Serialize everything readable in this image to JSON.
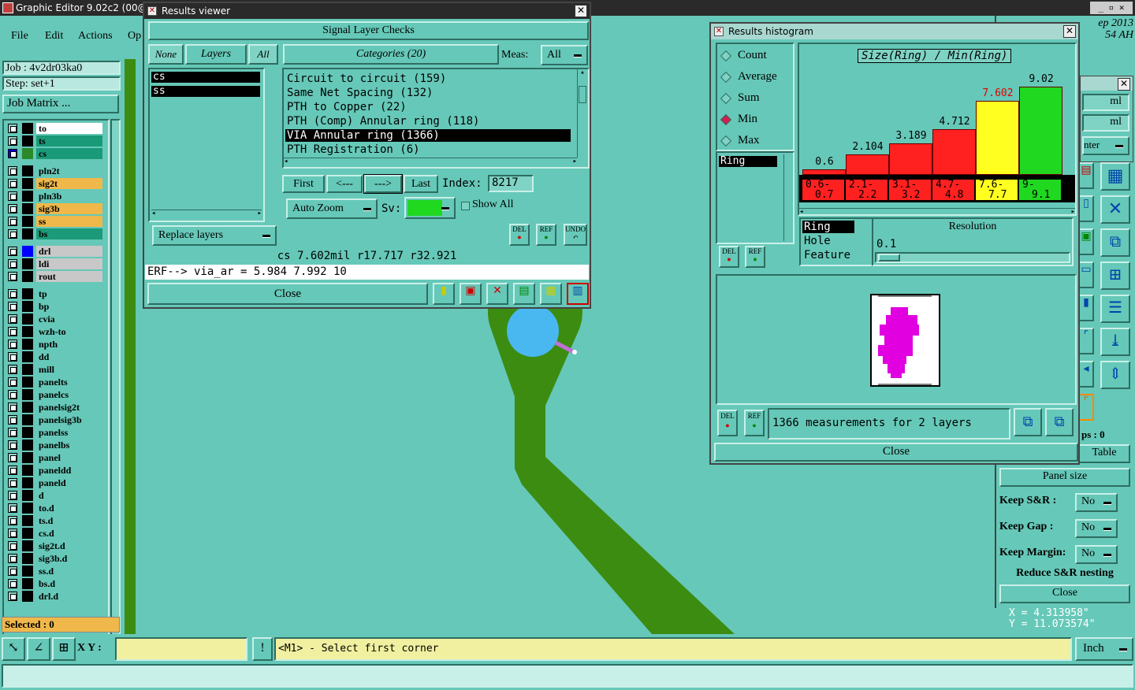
{
  "app": {
    "title": "Graphic Editor 9.02c2 (00@H",
    "date_frag1": "ep 2013",
    "date_frag2": "54 AH"
  },
  "menu": {
    "file": "File",
    "edit": "Edit",
    "actions": "Actions",
    "op": "Op"
  },
  "left": {
    "job": "Job : 4v2dr03ka0",
    "step": "Step: set+1",
    "job_matrix": "Job Matrix ...",
    "selected": "Selected : 0",
    "layers": [
      {
        "name": "to",
        "color": "#ffffff",
        "sw": "#000"
      },
      {
        "name": "ts",
        "color": "#1a9a78",
        "sw": "#000"
      },
      {
        "name": "cs",
        "color": "#1a9a78",
        "sw": "#2a8a2a",
        "active": true
      },
      {
        "name": "pln2t",
        "color": "#66c8b8",
        "sw": "#000"
      },
      {
        "name": "sig2t",
        "color": "#f0b84a",
        "sw": "#000"
      },
      {
        "name": "pln3b",
        "color": "#66c8b8",
        "sw": "#000"
      },
      {
        "name": "sig3b",
        "color": "#f0b84a",
        "sw": "#000"
      },
      {
        "name": "ss",
        "color": "#f0b84a",
        "sw": "#000"
      },
      {
        "name": "bs",
        "color": "#1a9a78",
        "sw": "#000"
      },
      {
        "name": "drl",
        "color": "#c8c8c8",
        "sw": "#0000ff"
      },
      {
        "name": "ldi",
        "color": "#c8c8c8",
        "sw": "#000"
      },
      {
        "name": "rout",
        "color": "#c8c8c8",
        "sw": "#000"
      },
      {
        "name": "tp",
        "color": "#66c8b8",
        "sw": "#000"
      },
      {
        "name": "bp",
        "color": "#66c8b8",
        "sw": "#000"
      },
      {
        "name": "cvia",
        "color": "#66c8b8",
        "sw": "#000"
      },
      {
        "name": "wzh-to",
        "color": "#66c8b8",
        "sw": "#000"
      },
      {
        "name": "npth",
        "color": "#66c8b8",
        "sw": "#000"
      },
      {
        "name": "dd",
        "color": "#66c8b8",
        "sw": "#000"
      },
      {
        "name": "mill",
        "color": "#66c8b8",
        "sw": "#000"
      },
      {
        "name": "panelts",
        "color": "#66c8b8",
        "sw": "#000"
      },
      {
        "name": "panelcs",
        "color": "#66c8b8",
        "sw": "#000"
      },
      {
        "name": "panelsig2t",
        "color": "#66c8b8",
        "sw": "#000"
      },
      {
        "name": "panelsig3b",
        "color": "#66c8b8",
        "sw": "#000"
      },
      {
        "name": "panelss",
        "color": "#66c8b8",
        "sw": "#000"
      },
      {
        "name": "panelbs",
        "color": "#66c8b8",
        "sw": "#000"
      },
      {
        "name": "panel",
        "color": "#66c8b8",
        "sw": "#000"
      },
      {
        "name": "paneldd",
        "color": "#66c8b8",
        "sw": "#000"
      },
      {
        "name": "paneld",
        "color": "#66c8b8",
        "sw": "#000"
      },
      {
        "name": "d",
        "color": "#66c8b8",
        "sw": "#000"
      },
      {
        "name": "to.d",
        "color": "#66c8b8",
        "sw": "#000"
      },
      {
        "name": "ts.d",
        "color": "#66c8b8",
        "sw": "#000"
      },
      {
        "name": "cs.d",
        "color": "#66c8b8",
        "sw": "#000"
      },
      {
        "name": "sig2t.d",
        "color": "#66c8b8",
        "sw": "#000"
      },
      {
        "name": "sig3b.d",
        "color": "#66c8b8",
        "sw": "#000"
      },
      {
        "name": "ss.d",
        "color": "#66c8b8",
        "sw": "#000"
      },
      {
        "name": "bs.d",
        "color": "#66c8b8",
        "sw": "#000"
      },
      {
        "name": "drl.d",
        "color": "#66c8b8",
        "sw": "#000"
      }
    ]
  },
  "rv": {
    "title": "Results viewer",
    "header": "Signal Layer Checks",
    "none": "None",
    "layers": "Layers",
    "all": "All",
    "categories": "Categories (20)",
    "meas_label": "Meas:",
    "meas_value": "All",
    "layer_items": [
      "cs",
      "ss"
    ],
    "cat_items": [
      "Circuit to circuit (159)",
      "Same Net Spacing (132)",
      "PTH to Copper (22)",
      "PTH (Comp) Annular ring (118)",
      "VIA Annular ring (1366)",
      "PTH Registration (6)"
    ],
    "first": "First",
    "prev": "<---",
    "next": "--->",
    "last": "Last",
    "index_label": "Index:",
    "index_value": "8217",
    "auto_zoom": "Auto Zoom",
    "sv": "Sv:",
    "show_all": "Show All",
    "replace": "Replace layers",
    "del": "DEL",
    "ref": "REF",
    "undo": "UNDO",
    "status": "cs 7.602mil  r17.717  r32.921",
    "erf": "ERF--> via_ar = 5.984 7.992 10",
    "close": "Close"
  },
  "rh": {
    "title": "Results histogram",
    "chart_title": "Size(Ring) / Min(Ring)",
    "modes": [
      "Count",
      "Average",
      "Sum",
      "Min",
      "Max"
    ],
    "selected_mode": "Min",
    "list_item": "Ring",
    "res_list": [
      "Ring",
      "Hole",
      "Feature"
    ],
    "resolution_label": "Resolution",
    "resolution_value": "0.1",
    "del": "DEL",
    "ref": "REF",
    "summary": "1366 measurements for 2 layers",
    "close": "Close"
  },
  "chart_data": {
    "type": "bar",
    "title": "Size(Ring) / Min(Ring)",
    "categories": [
      "0.6-0.7",
      "2.1-2.2",
      "3.1-3.2",
      "4.7-4.8",
      "7.6-7.7",
      "9-9.1"
    ],
    "cat_top": [
      "0.6-",
      "2.1-",
      "3.1-",
      "4.7-",
      "7.6-",
      "9-"
    ],
    "cat_bot": [
      "0.7",
      "2.2",
      "3.2",
      "4.8",
      "7.7",
      "9.1"
    ],
    "values": [
      0.6,
      2.104,
      3.189,
      4.712,
      7.602,
      9.02
    ],
    "labels": [
      "0.6",
      "2.104",
      "3.189",
      "4.712",
      "7.602",
      "9.02"
    ],
    "colors": [
      "#ff2020",
      "#ff2020",
      "#ff2020",
      "#ff2020",
      "#ffff20",
      "#20d820"
    ],
    "ylim": [
      0,
      9.02
    ],
    "highlight": "7.602"
  },
  "rp": {
    "ml1": "ml",
    "ml2": "ml",
    "nter": "nter",
    "ps": "ps : 0",
    "table": "Table",
    "panel_size": "Panel size",
    "keep_sr": "Keep S&R  :",
    "keep_gap": "Keep Gap   :",
    "keep_margin": "Keep Margin:",
    "no": "No",
    "reduce": "Reduce S&R nesting",
    "close": "Close",
    "x": "X = 4.313958\"",
    "y": "Y = 11.073574\""
  },
  "bottom": {
    "xy": "X Y :",
    "prompt": "<M1> - Select first corner",
    "unit": "Inch"
  }
}
